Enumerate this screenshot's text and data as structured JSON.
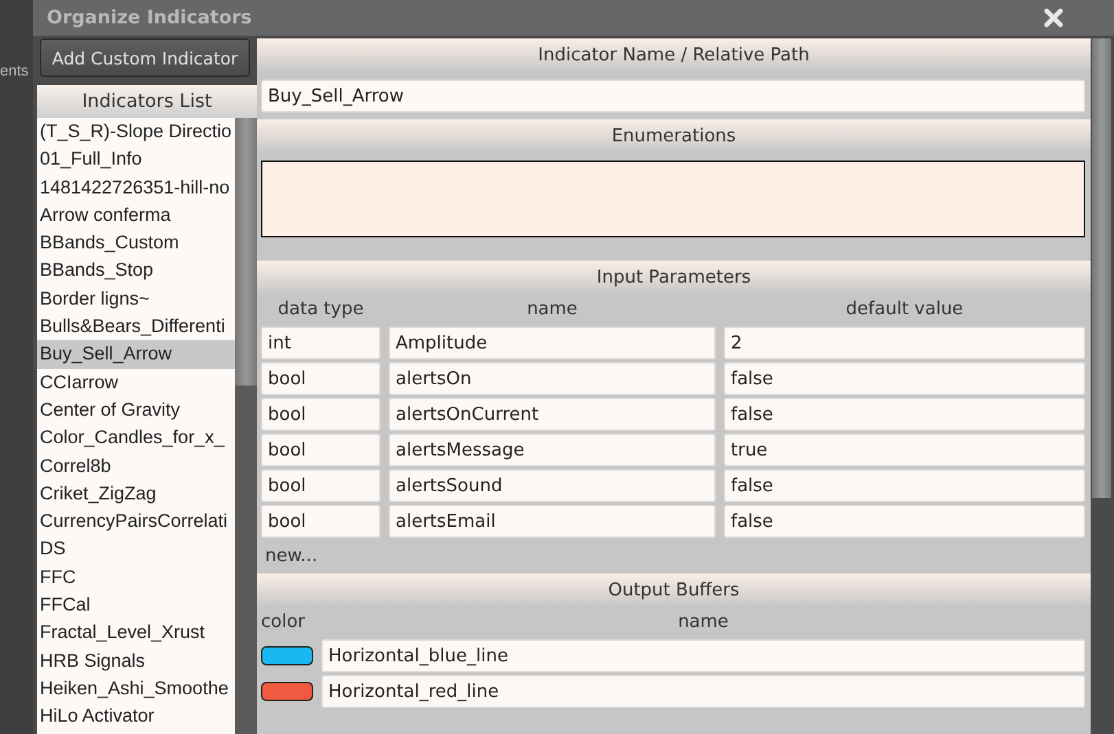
{
  "behind": {
    "text": "ents"
  },
  "window": {
    "title": "Organize Indicators"
  },
  "add_button": "Add Custom Indicator",
  "indicators_list": {
    "title": "Indicators List",
    "items": [
      {
        "label": "(T_S_R)-Slope Directio",
        "selected": false
      },
      {
        "label": "01_Full_Info",
        "selected": false
      },
      {
        "label": "1481422726351-hill-no",
        "selected": false
      },
      {
        "label": "Arrow conferma",
        "selected": false
      },
      {
        "label": "BBands_Custom",
        "selected": false
      },
      {
        "label": "BBands_Stop",
        "selected": false
      },
      {
        "label": "Border ligns~",
        "selected": false
      },
      {
        "label": "Bulls&Bears_Differenti",
        "selected": false
      },
      {
        "label": "Buy_Sell_Arrow",
        "selected": true
      },
      {
        "label": "CCIarrow",
        "selected": false
      },
      {
        "label": "Center of Gravity",
        "selected": false
      },
      {
        "label": "Color_Candles_for_x_",
        "selected": false
      },
      {
        "label": "Correl8b",
        "selected": false
      },
      {
        "label": "Criket_ZigZag",
        "selected": false
      },
      {
        "label": "CurrencyPairsCorrelati",
        "selected": false
      },
      {
        "label": "DS",
        "selected": false
      },
      {
        "label": "FFC",
        "selected": false
      },
      {
        "label": "FFCal",
        "selected": false
      },
      {
        "label": "Fractal_Level_Xrust",
        "selected": false
      },
      {
        "label": "HRB Signals",
        "selected": false
      },
      {
        "label": "Heiken_Ashi_Smoothe",
        "selected": false
      },
      {
        "label": "HiLo Activator",
        "selected": false
      }
    ]
  },
  "name_section": {
    "title": "Indicator Name / Relative Path",
    "value": "Buy_Sell_Arrow"
  },
  "enumerations": {
    "title": "Enumerations"
  },
  "input_parameters": {
    "title": "Input Parameters",
    "columns": [
      "data type",
      "name",
      "default value"
    ],
    "rows": [
      {
        "data_type": "int",
        "name": "Amplitude",
        "default_value": "2"
      },
      {
        "data_type": "bool",
        "name": "alertsOn",
        "default_value": "false"
      },
      {
        "data_type": "bool",
        "name": "alertsOnCurrent",
        "default_value": "false"
      },
      {
        "data_type": "bool",
        "name": "alertsMessage",
        "default_value": "true"
      },
      {
        "data_type": "bool",
        "name": "alertsSound",
        "default_value": "false"
      },
      {
        "data_type": "bool",
        "name": "alertsEmail",
        "default_value": "false"
      }
    ],
    "new_link": "new..."
  },
  "output_buffers": {
    "title": "Output Buffers",
    "columns": [
      "color",
      "name"
    ],
    "rows": [
      {
        "color": "#1ab8f0",
        "name": "Horizontal_blue_line"
      },
      {
        "color": "#f05a40",
        "name": "Horizontal_red_line"
      }
    ]
  }
}
